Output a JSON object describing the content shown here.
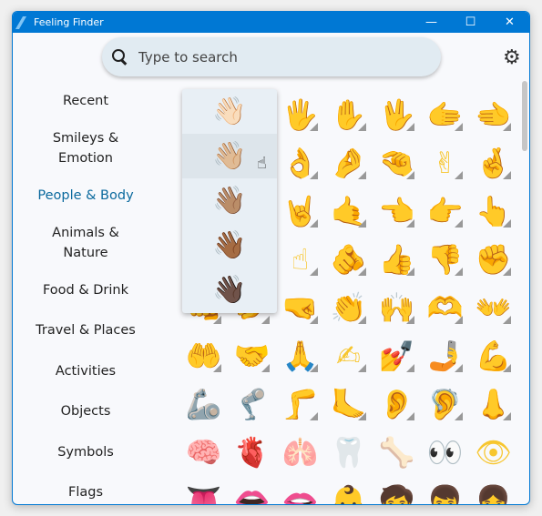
{
  "window": {
    "title": "Feeling Finder",
    "accent": "#0078d4",
    "controls": {
      "minimize": "—",
      "maximize": "☐",
      "close": "✕"
    }
  },
  "search": {
    "placeholder": "Type to search",
    "value": ""
  },
  "settings": {
    "icon": "gear-icon",
    "glyph": "⚙"
  },
  "sidebar": {
    "items": [
      {
        "label": "Recent"
      },
      {
        "label": "Smileys & Emotion"
      },
      {
        "label": "People & Body",
        "active": true
      },
      {
        "label": "Animals & Nature"
      },
      {
        "label": "Food & Drink"
      },
      {
        "label": "Travel & Places"
      },
      {
        "label": "Activities"
      },
      {
        "label": "Objects"
      },
      {
        "label": "Symbols"
      },
      {
        "label": "Flags"
      }
    ]
  },
  "grid": {
    "emojis": [
      {
        "e": "👋",
        "t": 1
      },
      {
        "e": "🤚",
        "t": 1
      },
      {
        "e": "🖐",
        "t": 1
      },
      {
        "e": "✋",
        "t": 1
      },
      {
        "e": "🖖",
        "t": 1
      },
      {
        "e": "🫱",
        "t": 1
      },
      {
        "e": "🫲",
        "t": 1
      },
      {
        "e": "🫳",
        "t": 1
      },
      {
        "e": "🫴",
        "t": 1
      },
      {
        "e": "👌",
        "t": 1
      },
      {
        "e": "🤌",
        "t": 1
      },
      {
        "e": "🤏",
        "t": 1
      },
      {
        "e": "✌",
        "t": 1
      },
      {
        "e": "🤞",
        "t": 1
      },
      {
        "e": "🫰",
        "t": 1
      },
      {
        "e": "🤟",
        "t": 1
      },
      {
        "e": "🤘",
        "t": 1
      },
      {
        "e": "🤙",
        "t": 1
      },
      {
        "e": "👈",
        "t": 1
      },
      {
        "e": "👉",
        "t": 1
      },
      {
        "e": "👆",
        "t": 1
      },
      {
        "e": "🖕",
        "t": 1
      },
      {
        "e": "👇",
        "t": 1
      },
      {
        "e": "☝",
        "t": 1
      },
      {
        "e": "🫵",
        "t": 1
      },
      {
        "e": "👍",
        "t": 1
      },
      {
        "e": "👎",
        "t": 1
      },
      {
        "e": "✊",
        "t": 1
      },
      {
        "e": "👊",
        "t": 1
      },
      {
        "e": "🤛",
        "t": 1
      },
      {
        "e": "🤜",
        "t": 1
      },
      {
        "e": "👏",
        "t": 1
      },
      {
        "e": "🙌",
        "t": 1
      },
      {
        "e": "🫶",
        "t": 1
      },
      {
        "e": "👐",
        "t": 1
      },
      {
        "e": "🤲",
        "t": 1
      },
      {
        "e": "🤝",
        "t": 1
      },
      {
        "e": "🙏",
        "t": 1
      },
      {
        "e": "✍",
        "t": 1
      },
      {
        "e": "💅",
        "t": 1
      },
      {
        "e": "🤳",
        "t": 1
      },
      {
        "e": "💪",
        "t": 1
      },
      {
        "e": "🦾",
        "t": 0
      },
      {
        "e": "🦿",
        "t": 0
      },
      {
        "e": "🦵",
        "t": 1
      },
      {
        "e": "🦶",
        "t": 1
      },
      {
        "e": "👂",
        "t": 1
      },
      {
        "e": "🦻",
        "t": 1
      },
      {
        "e": "👃",
        "t": 1
      },
      {
        "e": "🧠",
        "t": 0
      },
      {
        "e": "🫀",
        "t": 0
      },
      {
        "e": "🫁",
        "t": 0
      },
      {
        "e": "🦷",
        "t": 0
      },
      {
        "e": "🦴",
        "t": 0
      },
      {
        "e": "👀",
        "t": 0
      },
      {
        "e": "👁",
        "t": 0
      },
      {
        "e": "👅",
        "t": 0
      },
      {
        "e": "👄",
        "t": 0
      },
      {
        "e": "🫦",
        "t": 0
      },
      {
        "e": "👶",
        "t": 1
      },
      {
        "e": "🧒",
        "t": 1
      },
      {
        "e": "👦",
        "t": 1
      },
      {
        "e": "👧",
        "t": 1
      }
    ]
  },
  "skin_tone_popup": {
    "hovered_index": 1,
    "items": [
      "👋🏻",
      "👋🏼",
      "👋🏽",
      "👋🏾",
      "👋🏿"
    ]
  }
}
